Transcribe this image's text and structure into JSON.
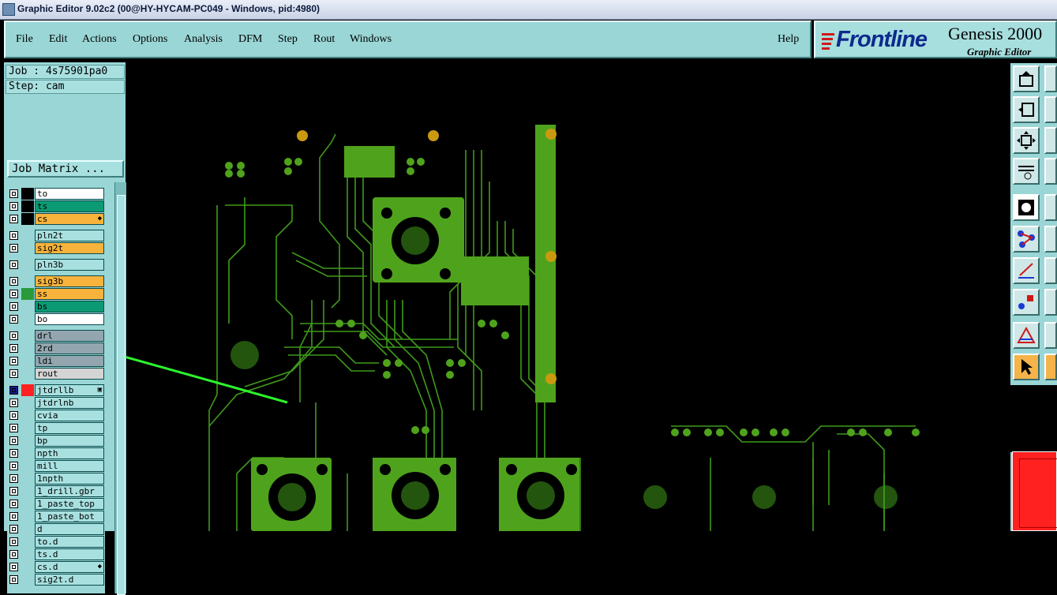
{
  "window": {
    "title": "Graphic Editor 9.02c2 (00@HY-HYCAM-PC049 - Windows, pid:4980)"
  },
  "menu": {
    "items": [
      "File",
      "Edit",
      "Actions",
      "Options",
      "Analysis",
      "DFM",
      "Step",
      "Rout",
      "Windows"
    ],
    "help": "Help"
  },
  "logo": {
    "brand": "Frontline",
    "product": "Genesis 2000",
    "subtitle": "Graphic Editor"
  },
  "job": {
    "job_label": "Job : 4s75901pa0",
    "step_label": "Step: cam",
    "matrix_button": "Job Matrix ..."
  },
  "layers": [
    {
      "name": "to",
      "bg": "#ffffff",
      "swatch": "#000000"
    },
    {
      "name": "ts",
      "bg": "#0b9a74",
      "swatch": "#000000"
    },
    {
      "name": "cs",
      "bg": "#f7b33b",
      "swatch": "#000000",
      "sym": "◆"
    },
    {
      "name": "pln2t",
      "bg": "#a8e0e0",
      "swatch": "#9ad6d6"
    },
    {
      "name": "sig2t",
      "bg": "#f7b33b",
      "swatch": "#9ad6d6"
    },
    {
      "name": "pln3b",
      "bg": "#a8e0e0",
      "swatch": "#9ad6d6"
    },
    {
      "name": "sig3b",
      "bg": "#f7b33b",
      "swatch": "#9ad6d6"
    },
    {
      "name": "ss",
      "bg": "#f7b33b",
      "swatch": "#2a9a3a"
    },
    {
      "name": "bs",
      "bg": "#0b9a74",
      "swatch": "#9ad6d6"
    },
    {
      "name": "bo",
      "bg": "#ffffff",
      "swatch": "#9ad6d6"
    },
    {
      "name": "drl",
      "bg": "#93a6b0",
      "swatch": "#9ad6d6"
    },
    {
      "name": "2rd",
      "bg": "#93a6b0",
      "swatch": "#9ad6d6"
    },
    {
      "name": "ldi",
      "bg": "#93a6b0",
      "swatch": "#9ad6d6"
    },
    {
      "name": "rout",
      "bg": "#d4d4d4",
      "swatch": "#9ad6d6"
    },
    {
      "name": "jtdrllb",
      "bg": "#a8e0e0",
      "swatch": "#ff2020",
      "sym": "▣",
      "active": true
    },
    {
      "name": "jtdrlnb",
      "bg": "#a8e0e0",
      "swatch": "#9ad6d6"
    },
    {
      "name": "cvia",
      "bg": "#a8e0e0",
      "swatch": "#9ad6d6"
    },
    {
      "name": "tp",
      "bg": "#a8e0e0",
      "swatch": "#9ad6d6"
    },
    {
      "name": "bp",
      "bg": "#a8e0e0",
      "swatch": "#9ad6d6"
    },
    {
      "name": "npth",
      "bg": "#a8e0e0",
      "swatch": "#9ad6d6"
    },
    {
      "name": "mill",
      "bg": "#a8e0e0",
      "swatch": "#9ad6d6"
    },
    {
      "name": "1npth",
      "bg": "#a8e0e0",
      "swatch": "#9ad6d6"
    },
    {
      "name": "1_drill.gbr",
      "bg": "#a8e0e0",
      "swatch": "#9ad6d6"
    },
    {
      "name": "1_paste_top",
      "bg": "#a8e0e0",
      "swatch": "#9ad6d6"
    },
    {
      "name": "1_paste_bot",
      "bg": "#a8e0e0",
      "swatch": "#9ad6d6"
    },
    {
      "name": "d",
      "bg": "#a8e0e0",
      "swatch": "#9ad6d6"
    },
    {
      "name": "to.d",
      "bg": "#a8e0e0",
      "swatch": "#9ad6d6"
    },
    {
      "name": "ts.d",
      "bg": "#a8e0e0",
      "swatch": "#9ad6d6"
    },
    {
      "name": "cs.d",
      "bg": "#a8e0e0",
      "swatch": "#9ad6d6",
      "sym": "◆"
    },
    {
      "name": "sig2t.d",
      "bg": "#a8e0e0",
      "swatch": "#9ad6d6"
    }
  ],
  "tools": [
    {
      "icon": "export-icon"
    },
    {
      "icon": "move-in-icon"
    },
    {
      "icon": "fit-screen-icon"
    },
    {
      "icon": "tools-palette-icon"
    },
    {
      "icon": "feature-select-icon"
    },
    {
      "icon": "net-icon"
    },
    {
      "icon": "measure-line-icon"
    },
    {
      "icon": "snap-point-icon"
    },
    {
      "icon": "triangle-icon"
    },
    {
      "icon": "pointer-icon"
    }
  ],
  "colors": {
    "panel": "#9ad6d6",
    "board": "#4fa31c",
    "pad_gold": "#c99a10",
    "arrow": "#2cf52c",
    "title": "#c9d3e6"
  }
}
